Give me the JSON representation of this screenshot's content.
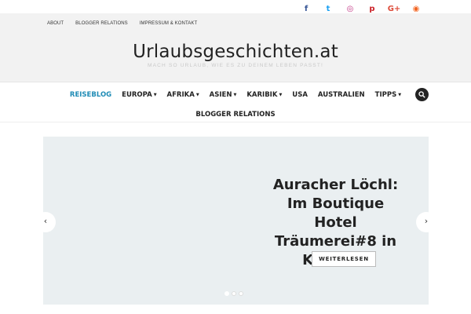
{
  "social": {
    "icons": [
      {
        "name": "facebook-icon",
        "glyph": "f",
        "color": "#3b5998"
      },
      {
        "name": "twitter-icon",
        "glyph": "t",
        "color": "#1da1f2"
      },
      {
        "name": "instagram-icon",
        "glyph": "◎",
        "color": "#c13584"
      },
      {
        "name": "pinterest-icon",
        "glyph": "p",
        "color": "#cb2027"
      },
      {
        "name": "google-plus-icon",
        "glyph": "G+",
        "color": "#dd4b39"
      },
      {
        "name": "rss-icon",
        "glyph": "◉",
        "color": "#f26522"
      }
    ]
  },
  "util_nav": {
    "items": [
      "ABOUT",
      "BLOGGER RELATIONS",
      "IMPRESSUM & KONTAKT"
    ]
  },
  "header": {
    "title": "Urlaubsgeschichten.at",
    "tagline": "Mach so Urlaub, wie es zu deinem Leben passt!"
  },
  "main_nav": {
    "items": [
      {
        "label": "REISEBLOG",
        "dropdown": false,
        "active": true
      },
      {
        "label": "EUROPA",
        "dropdown": true,
        "active": false
      },
      {
        "label": "AFRIKA",
        "dropdown": true,
        "active": false
      },
      {
        "label": "ASIEN",
        "dropdown": true,
        "active": false
      },
      {
        "label": "KARIBIK",
        "dropdown": true,
        "active": false
      },
      {
        "label": "USA",
        "dropdown": false,
        "active": false
      },
      {
        "label": "AUSTRALIEN",
        "dropdown": false,
        "active": false
      },
      {
        "label": "TIPPS",
        "dropdown": true,
        "active": false
      }
    ],
    "second_row": "BLOGGER RELATIONS",
    "accent": "#1e8bb5"
  },
  "slider": {
    "title": "Auracher Löchl: Im Boutique Hotel Träumerei#8 in Kufstein",
    "button": "WEITERLESEN",
    "prev": "‹",
    "next": "›",
    "dots": 3,
    "active_dot": 0
  }
}
